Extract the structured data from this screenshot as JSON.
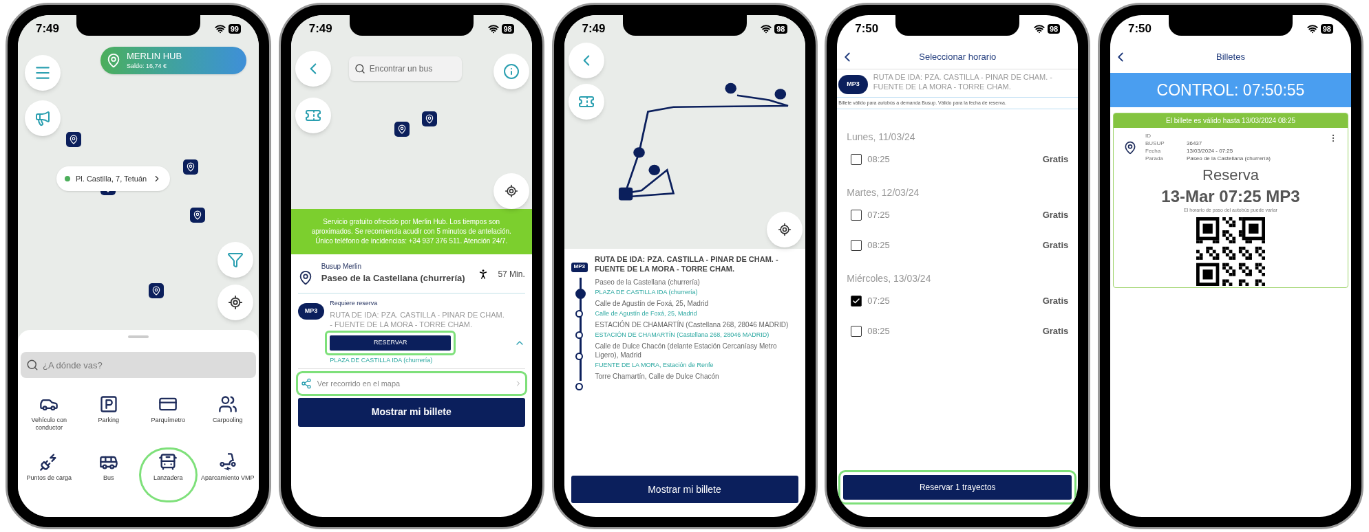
{
  "phones": [
    {
      "kind": "home",
      "status": {
        "time": "7:49",
        "battery": "99"
      },
      "hub": {
        "title": "MERLIN HUB",
        "balance": "Saldo: 16,74 €"
      },
      "location": "Pl. Castilla, 7, Tetuán",
      "search": {
        "placeholder": "¿A dónde vas?"
      },
      "services": [
        {
          "label": "Vehículo con conductor",
          "selected": false
        },
        {
          "label": "Parking",
          "selected": false
        },
        {
          "label": "Parquímetro",
          "selected": false
        },
        {
          "label": "Carpooling",
          "selected": false
        },
        {
          "label": "Puntos de carga",
          "selected": false
        },
        {
          "label": "Bus",
          "selected": false
        },
        {
          "label": "Lanzadera",
          "selected": true
        },
        {
          "label": "Aparcamiento VMP",
          "selected": false
        }
      ]
    },
    {
      "kind": "stop",
      "status": {
        "time": "7:49",
        "battery": "98"
      },
      "search": {
        "placeholder": "Encontrar un bus"
      },
      "notice": "Servicio gratuito ofrecido por Merlin Hub.  Los tiempos son aproximados. Se recomienda acudir con 5 minutos de antelación. Único teléfono de incidencias: +34 937 376 511. Atención 24/7.",
      "operator": "Busup Merlin",
      "stop": "Paseo de la Castellana (churrería)",
      "walk": "57 Min.",
      "line": {
        "badge": "MP3",
        "requirement": "Requiere reserva",
        "route": "RUTA DE IDA: PZA. CASTILLA - PINAR DE CHAM. - FUENTE DE LA MORA - TORRE CHAM.",
        "expanded": true
      },
      "reserve": {
        "label": "RESERVAR",
        "highlighted": true
      },
      "destination": "PLAZA DE CASTILLA IDA (churrería)",
      "map_link": {
        "label": "Ver recorrido en el mapa",
        "highlighted": true
      },
      "primary": "Mostrar mi billete"
    },
    {
      "kind": "route",
      "status": {
        "time": "7:49",
        "battery": "98"
      },
      "badge": "MP3",
      "title": "RUTA DE IDA: PZA. CASTILLA - PINAR DE CHAM. - FUENTE DE LA MORA - TORRE CHAM.",
      "stops": [
        {
          "name": "Paseo de la Castellana (churrería)",
          "sub": "PLAZA DE CASTILLA IDA (churrería)",
          "selected": true
        },
        {
          "name": "Calle de Agustín de Foxá, 25, Madrid",
          "sub": "Calle de Agustín de Foxá, 25, Madrid",
          "selected": false
        },
        {
          "name": "ESTACIÓN DE CHAMARTÍN (Castellana 268, 28046 MADRID)",
          "sub": "ESTACIÓN DE CHAMARTÍN (Castellana 268, 28046 MADRID)",
          "selected": false
        },
        {
          "name": "Calle de Dulce Chacón (delante Estación Cercaníasy Metro Ligero), Madrid",
          "sub": "FUENTE DE LA MORA, Estación de Renfe",
          "selected": false
        },
        {
          "name": "Torre Chamartín, Calle de Dulce Chacón",
          "selected": false
        }
      ],
      "primary": "Mostrar mi billete"
    },
    {
      "kind": "schedule",
      "status": {
        "time": "7:50",
        "battery": "98"
      },
      "title": "Seleccionar horario",
      "badge": "MP3",
      "route": "RUTA DE IDA: PZA. CASTILLA - PINAR DE CHAM. - FUENTE DE LA MORA - TORRE CHAM.",
      "notice": "Billete válido para autobús a demanda Busup. Válido para la fecha de reserva.",
      "days": [
        {
          "label": "Lunes, 11/03/24",
          "slots": [
            {
              "time": "08:25",
              "price": "Gratis",
              "checked": false
            }
          ]
        },
        {
          "label": "Martes, 12/03/24",
          "slots": [
            {
              "time": "07:25",
              "price": "Gratis",
              "checked": false
            },
            {
              "time": "08:25",
              "price": "Gratis",
              "checked": false
            }
          ]
        },
        {
          "label": "Miércoles, 13/03/24",
          "slots": [
            {
              "time": "07:25",
              "price": "Gratis",
              "checked": true
            },
            {
              "time": "08:25",
              "price": "Gratis",
              "checked": false
            }
          ]
        }
      ],
      "primary": {
        "label": "Reservar 1 trayectos",
        "highlighted": true
      }
    },
    {
      "kind": "ticket",
      "status": {
        "time": "7:50",
        "battery": "98"
      },
      "title": "Billetes",
      "control": "CONTROL: 07:50:55",
      "validity": "El billete es válido hasta 13/03/2024 08:25",
      "fields": [
        {
          "label": "ID BUSUP",
          "value": "36437"
        },
        {
          "label": "Fecha",
          "value": "13/03/2024 - 07:25"
        },
        {
          "label": "Parada",
          "value": "Paseo de la Castellana (churrería)"
        }
      ],
      "heading": "Reserva",
      "trip": "13-Mar 07:25 MP3",
      "note": "El horario de paso del autobús puede variar"
    }
  ]
}
